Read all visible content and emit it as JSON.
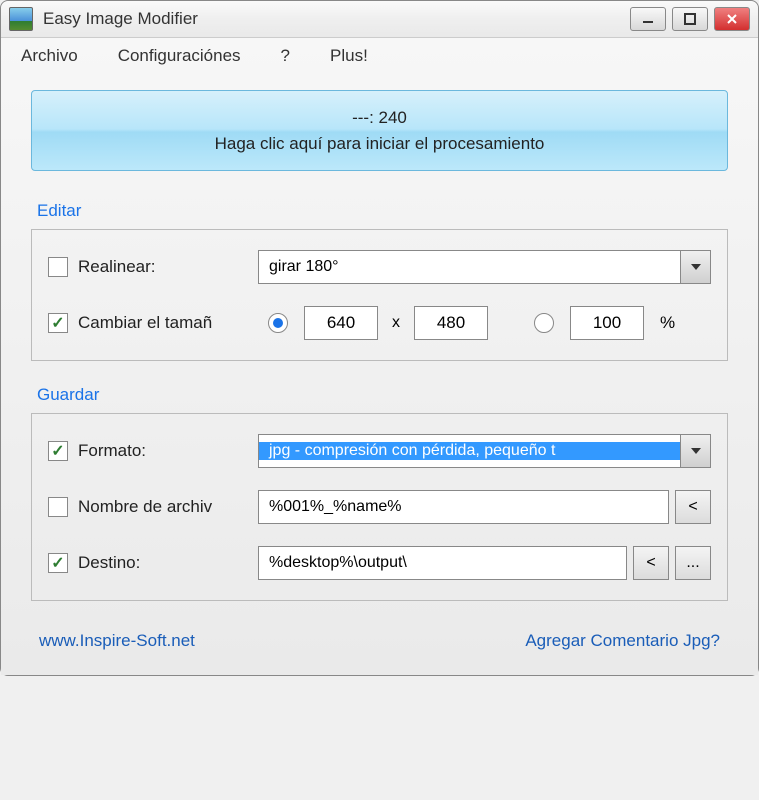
{
  "window": {
    "title": "Easy Image Modifier"
  },
  "menu": {
    "file": "Archivo",
    "config": "Configuraciónes",
    "help": "?",
    "plus": "Plus!"
  },
  "action": {
    "line1": "---: 240",
    "line2": "Haga clic aquí para iniciar el procesamiento"
  },
  "edit": {
    "title": "Editar",
    "realign_label": "Realinear:",
    "realign_value": "girar 180°",
    "resize_label": "Cambiar el tamañ",
    "width": "640",
    "height": "480",
    "x": "x",
    "percent": "100",
    "percent_symbol": "%"
  },
  "save": {
    "title": "Guardar",
    "format_label": "Formato:",
    "format_value": "jpg - compresión con pérdida, pequeño t",
    "name_label": "Nombre de archiv",
    "name_value": "%001%_%name%",
    "dest_label": "Destino:",
    "dest_value": "%desktop%\\output\\",
    "back": "<",
    "browse": "..."
  },
  "footer": {
    "site": "www.Inspire-Soft.net",
    "comment": "Agregar Comentario Jpg?"
  }
}
